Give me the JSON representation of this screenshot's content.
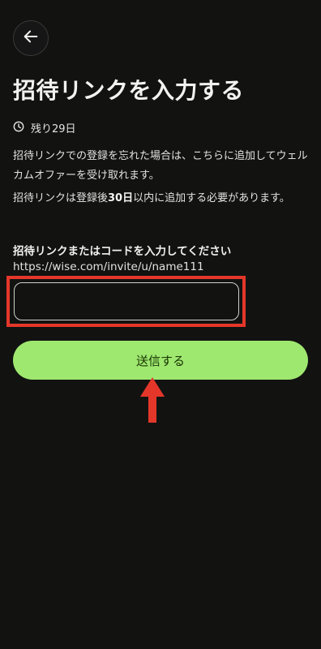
{
  "header": {
    "back_icon": "arrow-left-icon",
    "title": "招待リンクを入力する"
  },
  "status": {
    "clock_icon": "clock-icon",
    "remaining": "残り29日"
  },
  "info": {
    "paragraph1": "招待リンクでの登録を忘れた場合は、こちらに追加してウェルカムオファーを受け取れます。",
    "paragraph2_before": "招待リンクは登録後",
    "paragraph2_bold": "30日",
    "paragraph2_after": "以内に追加する必要があります。"
  },
  "form": {
    "label": "招待リンクまたはコードを入力してください",
    "hint": "https://wise.com/invite/u/name111",
    "value": ""
  },
  "submit": {
    "label": "送信する"
  },
  "annotations": {
    "highlight_color": "#e4372a",
    "arrow_icon": "arrow-up-icon"
  },
  "colors": {
    "background": "#121311",
    "accent": "#9fe870"
  }
}
